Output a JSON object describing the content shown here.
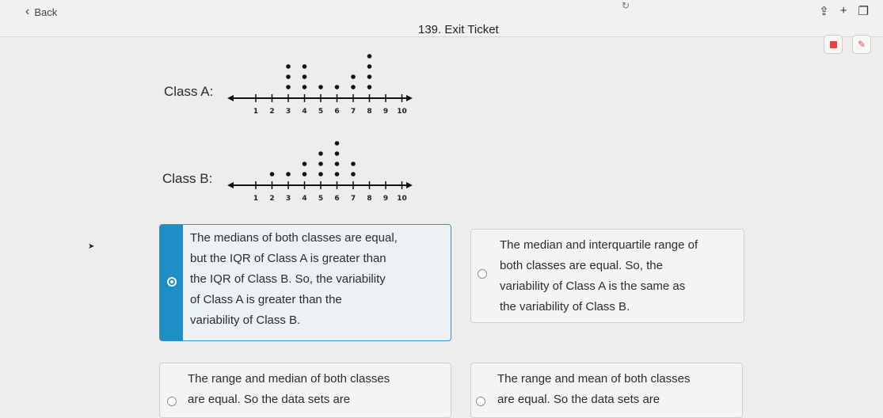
{
  "header": {
    "back_label": "Back",
    "title": "139. Exit Ticket",
    "icons": [
      "share-icon",
      "plus-icon",
      "tabs-icon"
    ]
  },
  "toolbar": {
    "icons": [
      "stop-icon",
      "pen-icon"
    ]
  },
  "plots": [
    {
      "label": "Class A:",
      "axis_ticks": [
        "1",
        "2",
        "3",
        "4",
        "5",
        "6",
        "7",
        "8",
        "9",
        "10"
      ],
      "dot_counts": [
        0,
        0,
        3,
        3,
        1,
        1,
        2,
        4,
        0,
        0
      ]
    },
    {
      "label": "Class B:",
      "axis_ticks": [
        "1",
        "2",
        "3",
        "4",
        "5",
        "6",
        "7",
        "8",
        "9",
        "10"
      ],
      "dot_counts": [
        0,
        1,
        1,
        2,
        3,
        4,
        2,
        0,
        0,
        0
      ]
    }
  ],
  "options": [
    {
      "lines": [
        "The medians of both classes are equal,",
        "but the IQR of Class A is greater than",
        "the IQR of Class B. So, the variability",
        "of Class A is greater than the",
        "variability of Class B."
      ],
      "selected": true
    },
    {
      "lines": [
        "The median and interquartile range of",
        "both classes are equal. So, the",
        "variability of Class A is the same as",
        "the variability of Class B."
      ],
      "selected": false
    },
    {
      "lines": [
        "The range and median of both classes",
        "are equal. So the data sets are"
      ],
      "selected": false
    },
    {
      "lines": [
        "The range and mean of both classes",
        "are equal. So the data sets are"
      ],
      "selected": false
    }
  ]
}
